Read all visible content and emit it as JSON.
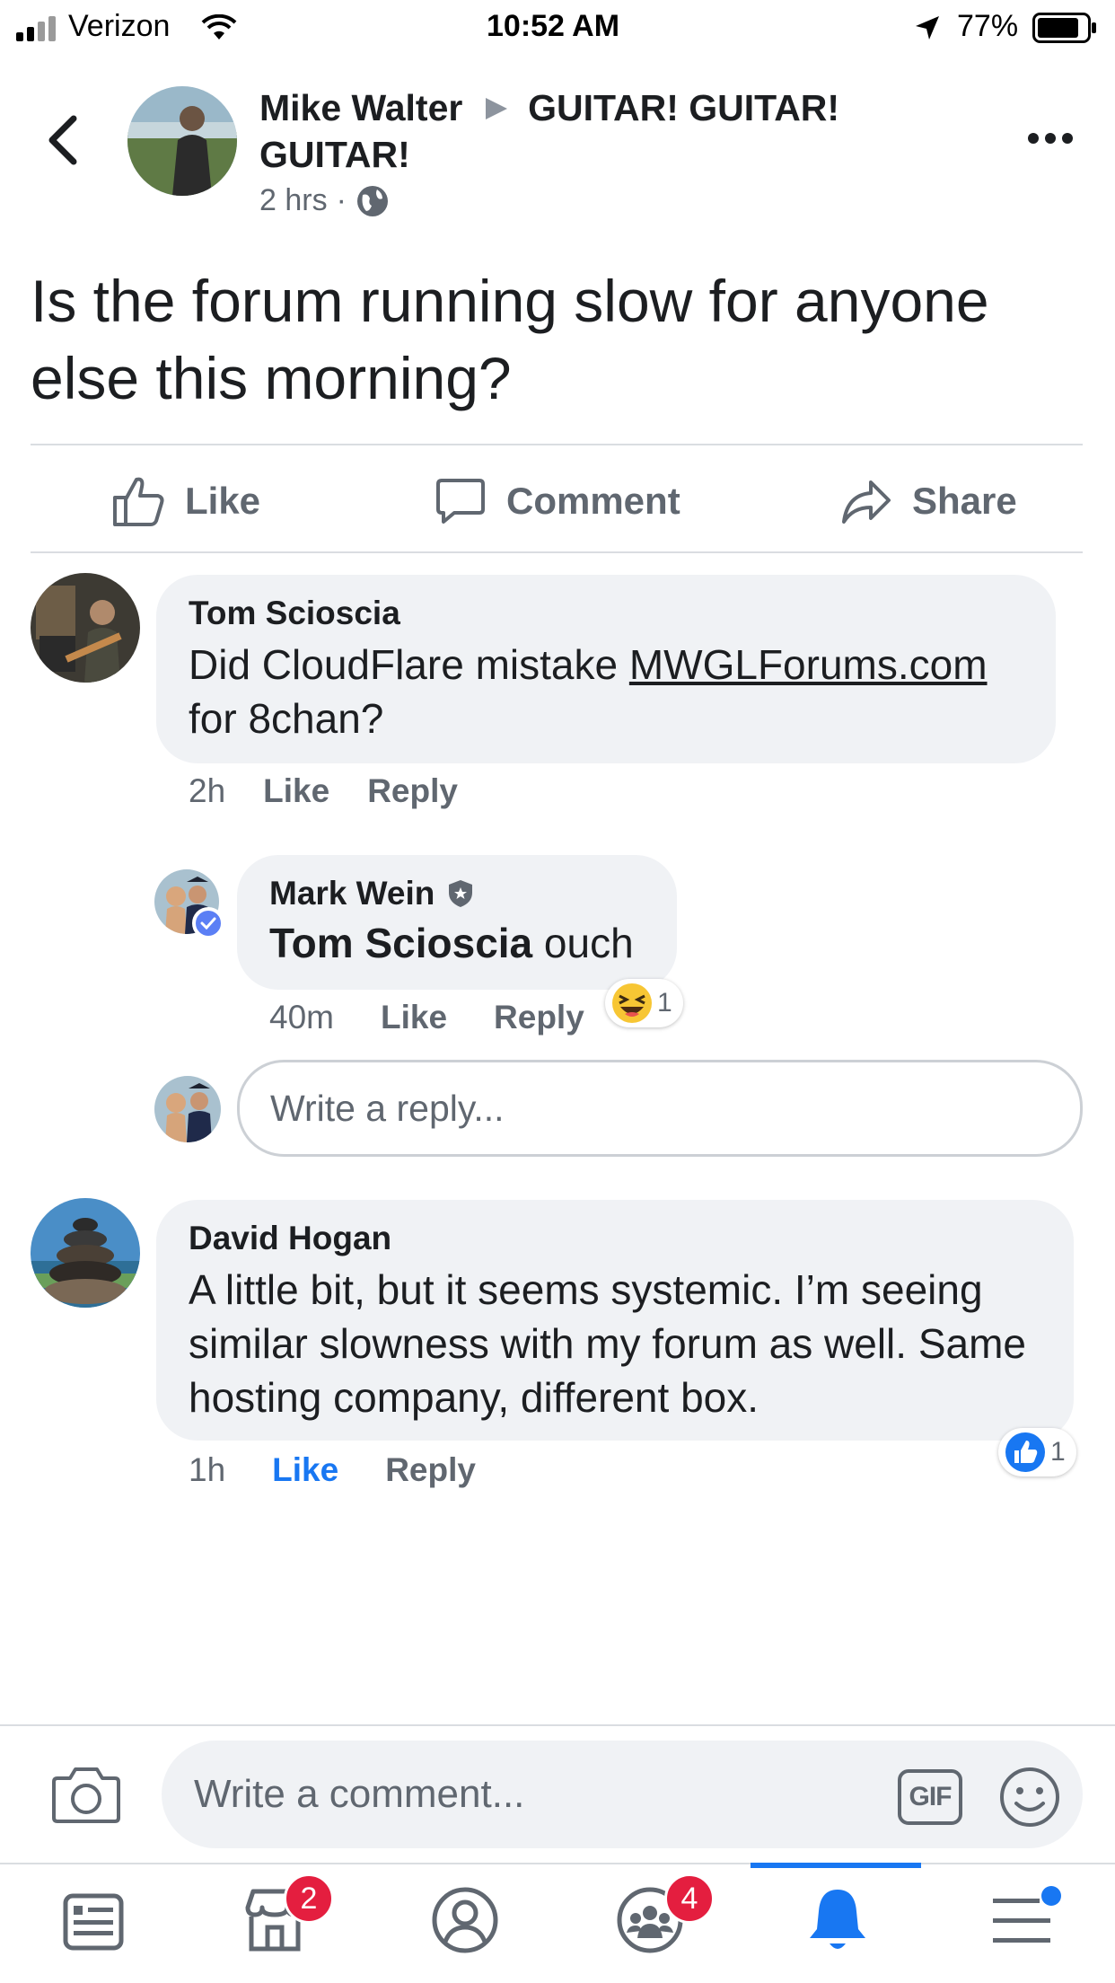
{
  "status_bar": {
    "carrier": "Verizon",
    "time": "10:52 AM",
    "battery": "77%"
  },
  "post": {
    "author": "Mike Walter",
    "group": "GUITAR! GUITAR! GUITAR!",
    "time": "2 hrs",
    "body": "Is the forum running slow for anyone else this morning?"
  },
  "actions": {
    "like": "Like",
    "comment": "Comment",
    "share": "Share"
  },
  "comments": [
    {
      "author": "Tom Scioscia",
      "text_before": "Did CloudFlare mistake ",
      "link": "MWGLForums.com",
      "text_after": " for 8chan?",
      "time": "2h",
      "like": "Like",
      "reply": "Reply"
    },
    {
      "author": "Mark Wein",
      "mention": "Tom Scioscia",
      "text": " ouch",
      "time": "40m",
      "like": "Like",
      "reply": "Reply",
      "reaction_count": "1"
    },
    {
      "author": "David Hogan",
      "text": "A little bit, but it seems systemic. I’m seeing similar slowness with my forum as well. Same hosting company, different box.",
      "time": "1h",
      "like": "Like",
      "reply": "Reply",
      "reaction_count": "1"
    }
  ],
  "reply_input": {
    "placeholder": "Write a reply..."
  },
  "comment_input": {
    "placeholder": "Write a comment...",
    "gif_label": "GIF"
  },
  "tab_bar": {
    "marketplace_badge": "2",
    "groups_badge": "4"
  },
  "colors": {
    "accent": "#1877f2",
    "badge": "#e41e3f",
    "bubble": "#f0f2f5"
  }
}
